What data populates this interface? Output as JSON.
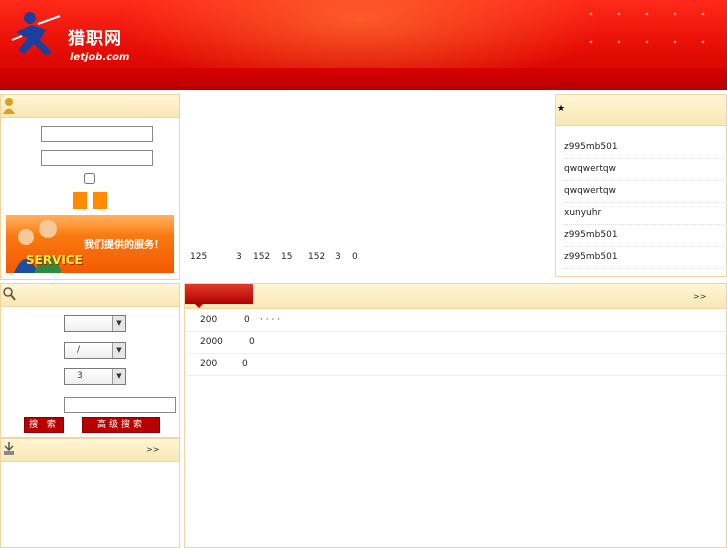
{
  "header": {
    "logo_text": "猎职网",
    "logo_sub": "letjob.com"
  },
  "login": {
    "username_value": "",
    "password_value": "",
    "banner_text": "我们提供的服务！",
    "banner_service": "SERVICE"
  },
  "search": {
    "select1": "",
    "select2": "/",
    "select3": "3",
    "keyword_value": "",
    "search_button": "搜 索",
    "advanced_button": "高级搜索"
  },
  "download": {
    "more": ">>"
  },
  "stats": [
    "125",
    "3",
    "152",
    "15",
    "152",
    "3",
    "0"
  ],
  "hot": {
    "star": "★",
    "items": [
      "z995mb501",
      "qwqwertqw",
      "qwqwertqw",
      "xunyuhr",
      "z995mb501",
      "z995mb501"
    ]
  },
  "news": {
    "more": ">>",
    "rows": [
      {
        "a": "200",
        "b": "0",
        "c": "· · · ·"
      },
      {
        "a": "2000",
        "b": "0",
        "c": ""
      },
      {
        "a": "200",
        "b": "0",
        "c": ""
      }
    ]
  },
  "colors": {
    "header_red": "#e60d05",
    "panel_border": "#f3d3a0",
    "panel_head": "#f9e7b4",
    "button_orange": "#ff8c00",
    "button_red": "#b80000"
  }
}
